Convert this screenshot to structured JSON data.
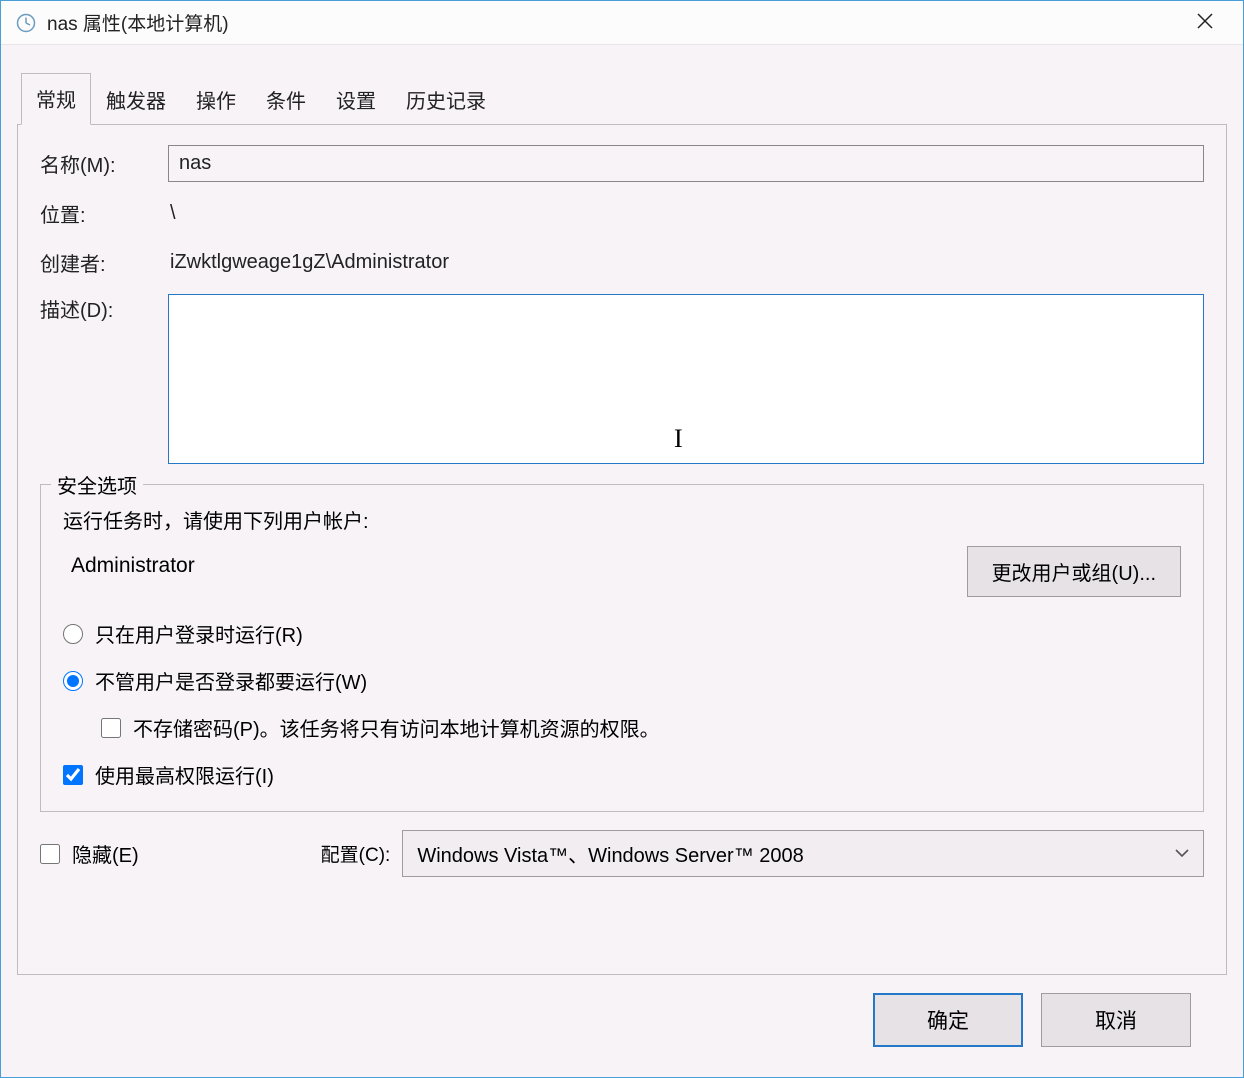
{
  "window": {
    "title": "nas 属性(本地计算机)"
  },
  "tabs": {
    "general": "常规",
    "triggers": "触发器",
    "actions": "操作",
    "conditions": "条件",
    "settings": "设置",
    "history": "历史记录"
  },
  "general": {
    "name_label": "名称(M):",
    "name_value": "nas",
    "location_label": "位置:",
    "location_value": "\\",
    "author_label": "创建者:",
    "author_value": "iZwktlgweage1gZ\\Administrator",
    "description_label": "描述(D):",
    "description_value": ""
  },
  "security": {
    "legend": "安全选项",
    "run_as_label": "运行任务时，请使用下列用户帐户:",
    "account_value": "Administrator",
    "change_user_btn": "更改用户或组(U)...",
    "radio_logged_on": "只在用户登录时运行(R)",
    "radio_any": "不管用户是否登录都要运行(W)",
    "no_store_pw": "不存储密码(P)。该任务将只有访问本地计算机资源的权限。",
    "highest_priv": "使用最高权限运行(I)"
  },
  "bottom": {
    "hidden_label": "隐藏(E)",
    "config_label": "配置(C):",
    "config_value": "Windows Vista™、Windows Server™ 2008"
  },
  "buttons": {
    "ok": "确定",
    "cancel": "取消"
  }
}
